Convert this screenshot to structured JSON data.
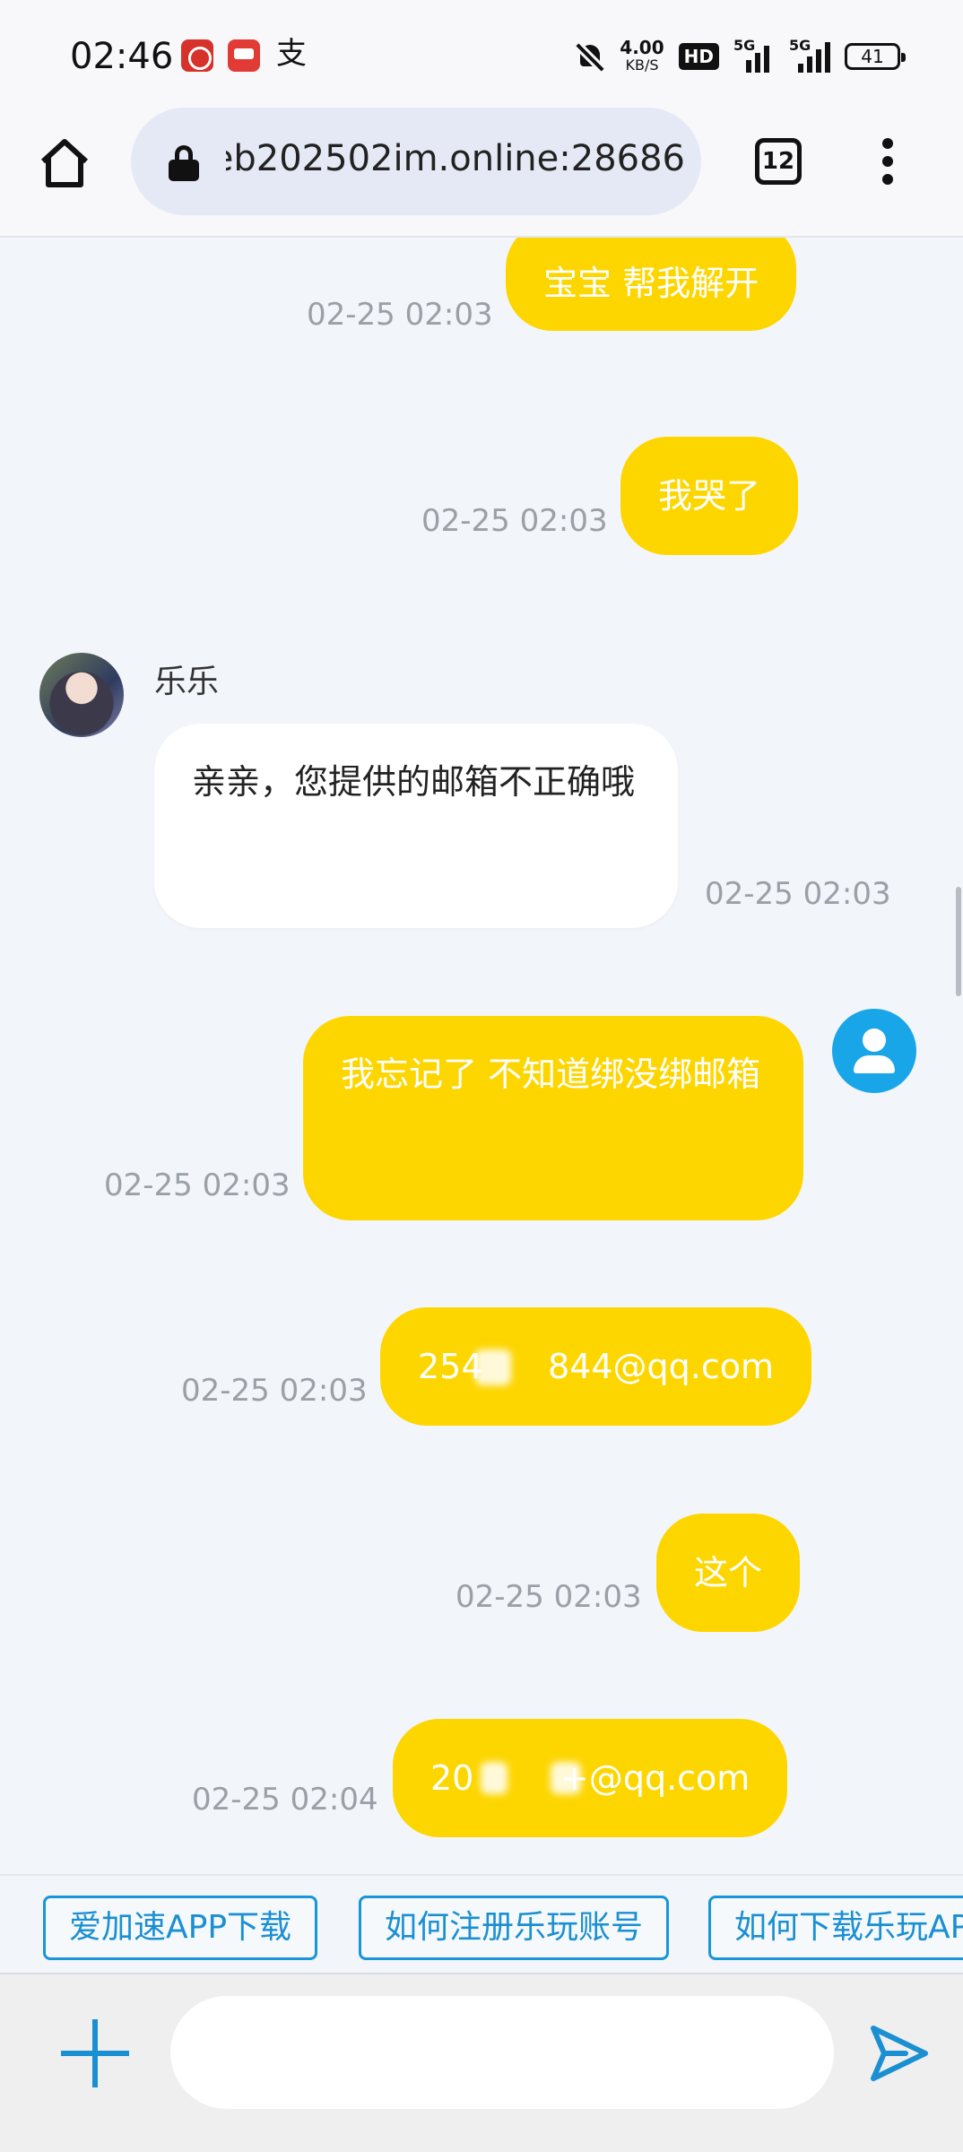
{
  "status_bar": {
    "time": "02:46",
    "net_speed": "4.00",
    "net_unit": "KB/S",
    "hd_label": "HD",
    "signal_1": "5G",
    "signal_2": "5G",
    "battery": "41",
    "icons": [
      "bank-app-icon",
      "payment-app-icon",
      "alipay-icon",
      "bell-off-icon",
      "signal-icon",
      "battery-icon"
    ]
  },
  "browser": {
    "url": "eb202502im.online:28686",
    "tab_count": "12"
  },
  "chat": {
    "messages": [
      {
        "sender": "me",
        "text": "宝宝 帮我解开",
        "time": "02-25 02:03"
      },
      {
        "sender": "me",
        "text": "我哭了",
        "time": "02-25 02:03"
      },
      {
        "sender": "other",
        "name": "乐乐",
        "text": "亲亲，您提供的邮箱不正确哦",
        "time": "02-25 02:03"
      },
      {
        "sender": "me",
        "text": "我忘记了 不知道绑没绑邮箱",
        "time": "02-25 02:03"
      },
      {
        "sender": "me",
        "text": "254      844@qq.com",
        "time": "02-25 02:03"
      },
      {
        "sender": "me",
        "text": "这个",
        "time": "02-25 02:03"
      },
      {
        "sender": "me",
        "text": "20        +@qq.com",
        "time": "02-25 02:04"
      }
    ]
  },
  "quick_replies": [
    "爱加速APP下载",
    "如何注册乐玩账号",
    "如何下载乐玩APP"
  ],
  "input": {
    "placeholder": ""
  },
  "colors": {
    "my_bubble": "#fdd600",
    "accent": "#1a8fd2",
    "background": "#f2f5f9"
  }
}
